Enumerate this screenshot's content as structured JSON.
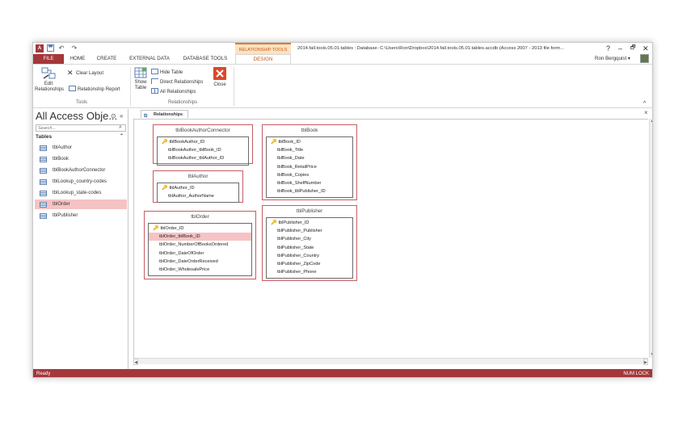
{
  "titlebar": {
    "app_icon": "A",
    "save_icon": "save-icon",
    "undo_label": "↶",
    "redo_label": "↷",
    "context_tools": "RELATIONSHIP TOOLS",
    "title": "2014.fall.tools.05.01.tables : Database- C:\\Users\\Ron\\Dropbox\\2014.fall.tools.05.01.tables.accdb (Access 2007 - 2013 file form...",
    "help": "?",
    "minimize": "–",
    "restore": "🗗",
    "close": "✕"
  },
  "tabs": [
    {
      "label": "FILE"
    },
    {
      "label": "HOME"
    },
    {
      "label": "CREATE"
    },
    {
      "label": "EXTERNAL DATA"
    },
    {
      "label": "DATABASE TOOLS"
    },
    {
      "label": "DESIGN"
    }
  ],
  "user": {
    "name": "Ron Bergquist ▾"
  },
  "ribbon": {
    "edit_relationships": "Edit Relationships",
    "clear_layout": "Clear Layout",
    "relationship_report": "Relationship Report",
    "tools_group": "Tools",
    "show_table": "Show Table",
    "hide_table": "Hide Table",
    "direct_relationships": "Direct Relationships",
    "all_relationships": "All Relationships",
    "close": "Close",
    "relationships_group": "Relationships",
    "collapse": "^"
  },
  "nav": {
    "title": "All Access Obje...",
    "chevron": "⊙",
    "collapse": "«",
    "search_placeholder": "Search...",
    "group": "Tables",
    "group_chevron": "⌃",
    "items": [
      {
        "label": "tblAuthor"
      },
      {
        "label": "tblBook"
      },
      {
        "label": "tblBookAuthorConnector"
      },
      {
        "label": "tblLookup_country-codes"
      },
      {
        "label": "tblLookup_state-codes"
      },
      {
        "label": "tblOrder"
      },
      {
        "label": "tblPublisher"
      }
    ]
  },
  "doc": {
    "tab_label": "Relationships",
    "close": "×"
  },
  "tables": {
    "connector": {
      "title": "tblBookAuthorConnector",
      "fields": [
        "tblBookAuthor_ID",
        "tblBookAuthor_tblBook_ID",
        "tblBookAuthor_tblAuthor_ID"
      ]
    },
    "author": {
      "title": "tblAuthor",
      "fields": [
        "tblAuthor_ID",
        "tblAuthor_AuthorName"
      ]
    },
    "order": {
      "title": "tblOrder",
      "fields": [
        "tblOrder_ID",
        "tblOrder_tblBook_ID",
        "tblOrder_NumberOfBooksOrdered",
        "tblOrder_DateOfOrder",
        "tblOrder_DateOrderReceived",
        "tblOrder_WholesalePrice"
      ]
    },
    "book": {
      "title": "tblBook",
      "fields": [
        "tblBook_ID",
        "tblBook_Title",
        "tblBook_Date",
        "tblBook_RetailPrice",
        "tblBook_Copies",
        "tblBook_ShelfNumber",
        "tblBook_tblPublisher_ID"
      ]
    },
    "publisher": {
      "title": "tblPublisher",
      "fields": [
        "tblPublisher_ID",
        "tblPublisher_Publisher",
        "tblPublisher_City",
        "tblPublisher_State",
        "tblPublisher_Country",
        "tblPublisher_ZipCode",
        "tblPublisher_Phone"
      ]
    }
  },
  "status": {
    "left": "Ready",
    "right": "NUM LOCK"
  },
  "colors": {
    "access_red": "#a4373a",
    "context_orange": "#c55a11",
    "selection_pink": "#f6c3c4"
  }
}
